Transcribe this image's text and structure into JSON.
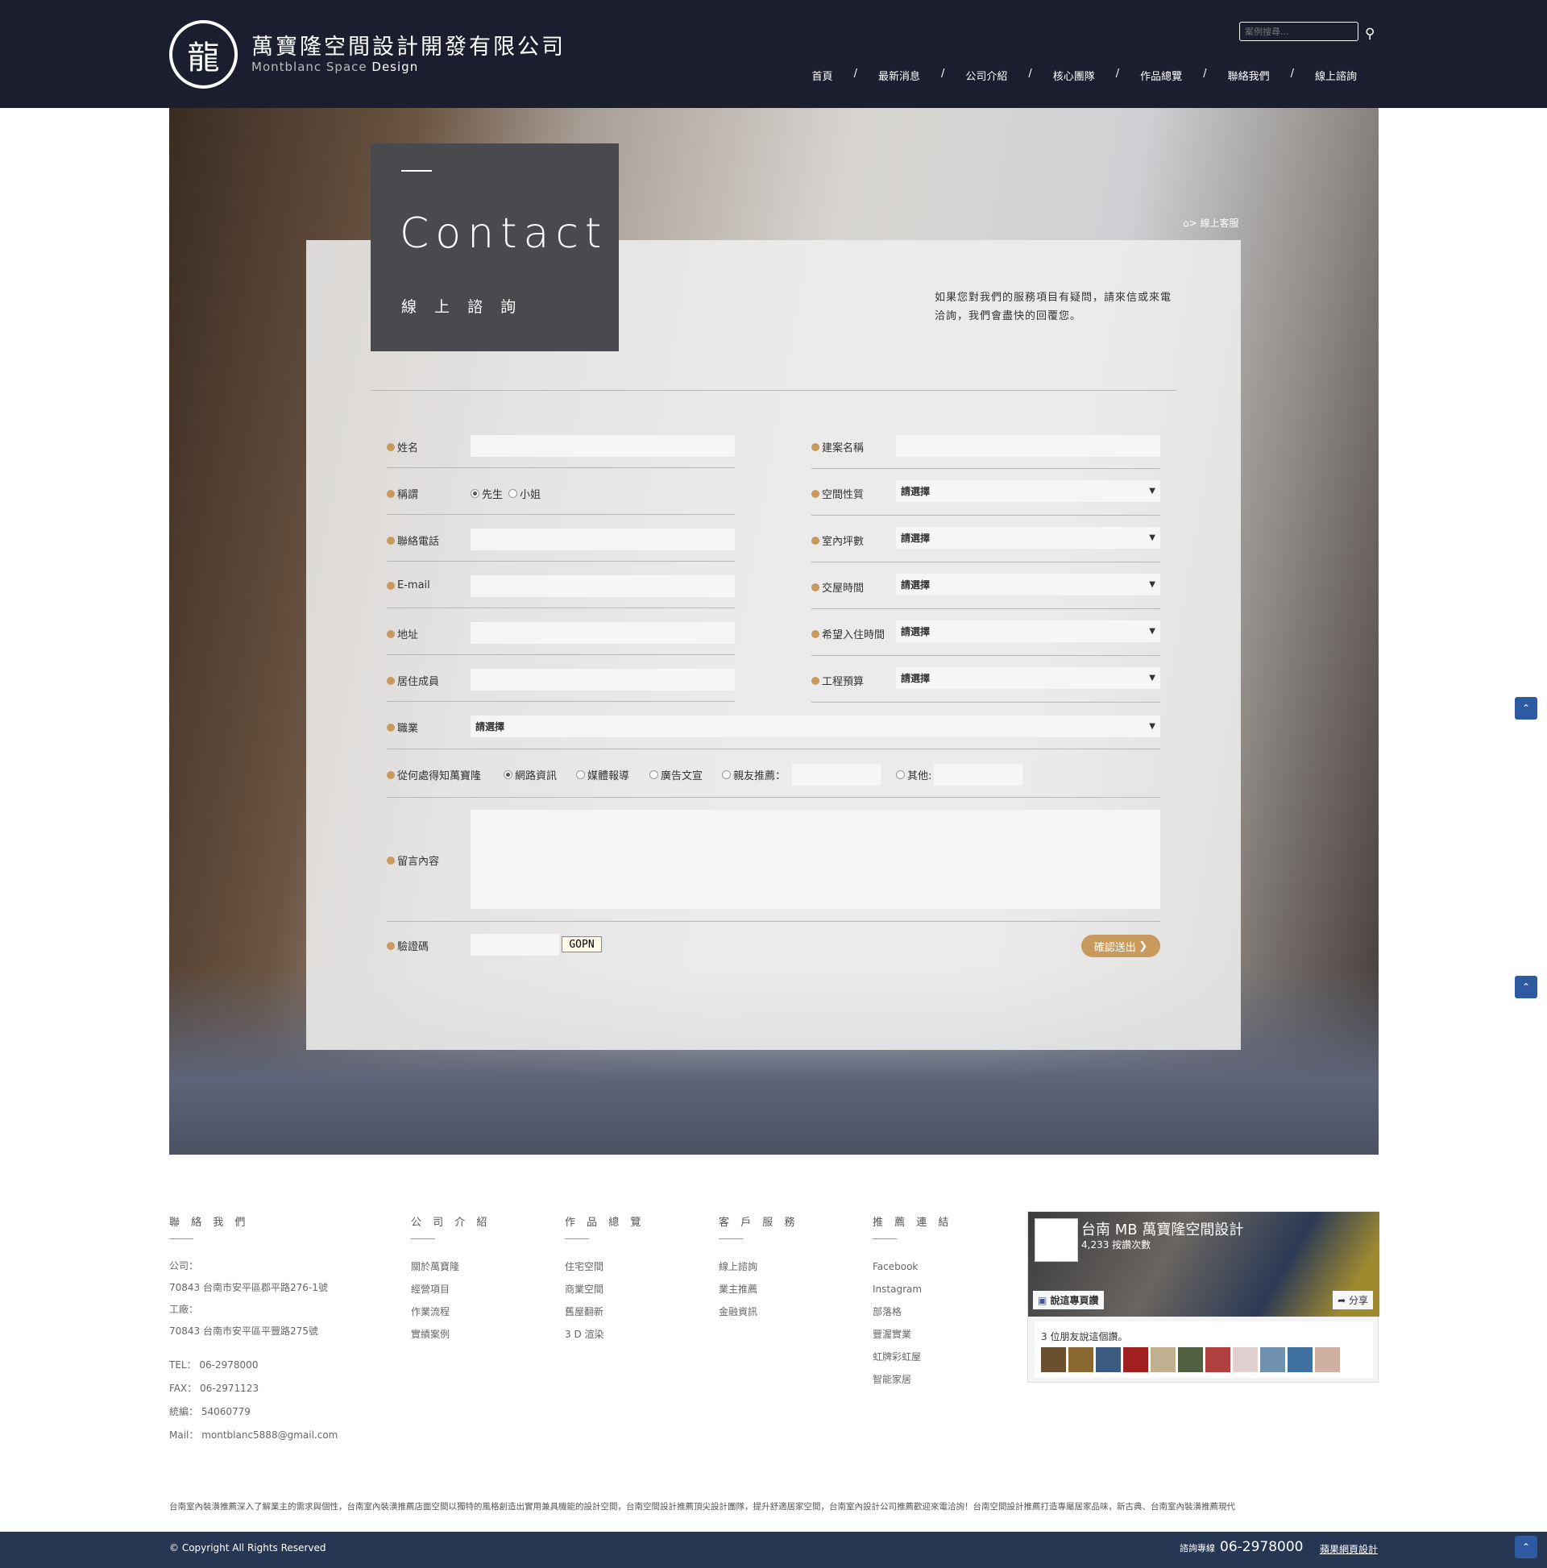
{
  "header": {
    "logo_icon": "dragon-emblem",
    "title": "萬寶隆空間設計開發有限公司",
    "subtitle_light": "Montblanc Space",
    "subtitle_bold": "Design",
    "search_placeholder": "案例搜尋...",
    "search_icon": "magnifier-icon",
    "nav": [
      "首頁",
      "最新消息",
      "公司介紹",
      "核心團隊",
      "作品總覽",
      "聯絡我們",
      "線上諮詢"
    ],
    "nav_separator": "/"
  },
  "hero": {
    "title_en": "Contact",
    "title_zh": "線 上 諮 詢",
    "breadcrumb_current": "線上客服",
    "breadcrumb_sep": ">",
    "intro": "如果您對我們的服務項目有疑問，請來信或來電洽詢，我們會盡快的回覆您。"
  },
  "form": {
    "left": [
      {
        "label": "姓名"
      },
      {
        "label": "稱謂",
        "options": [
          "先生",
          "小姐"
        ],
        "selected": "先生"
      },
      {
        "label": "聯絡電話"
      },
      {
        "label": "E-mail"
      },
      {
        "label": "地址"
      },
      {
        "label": "居住成員"
      }
    ],
    "right": [
      {
        "label": "建案名稱"
      },
      {
        "label": "空間性質",
        "value": "請選擇"
      },
      {
        "label": "室內坪數",
        "value": "請選擇"
      },
      {
        "label": "交屋時間",
        "value": "請選擇"
      },
      {
        "label": "希望入住時間",
        "value": "請選擇"
      },
      {
        "label": "工程預算",
        "value": "請選擇"
      }
    ],
    "occupation": {
      "label": "職業",
      "value": "請選擇"
    },
    "source": {
      "label": "從何處得知萬寶隆",
      "options": [
        "網路資訊",
        "媒體報導",
        "廣告文宣",
        "親友推薦：",
        "其他:"
      ],
      "selected": "網路資訊"
    },
    "message": {
      "label": "留言內容"
    },
    "captcha": {
      "label": "驗證碼",
      "code": "GOPN"
    },
    "submit": "確認送出",
    "accent": "#c89a5e"
  },
  "footer": {
    "contact": {
      "heading": "聯 絡 我 們",
      "lines": [
        "公司：",
        "70843 台南市安平區郡平路276-1號",
        "工廠：",
        "70843 台南市安平區平豐路275號",
        "",
        "TEL： 06-2978000",
        "FAX： 06-2971123",
        "統編： 54060779",
        "Mail： montblanc5888@gmail.com"
      ]
    },
    "columns": [
      {
        "heading": "公 司 介 紹",
        "items": [
          "關於萬寶隆",
          "經營項目",
          "作業流程",
          "實績案例"
        ]
      },
      {
        "heading": "作 品 總 覽",
        "items": [
          "住宅空間",
          "商業空間",
          "舊屋翻新",
          "3 D 渲染"
        ]
      },
      {
        "heading": "客 戶 服 務",
        "items": [
          "線上諮詢",
          "業主推薦",
          "金融資訊"
        ]
      },
      {
        "heading": "推 薦 連 結",
        "items": [
          "Facebook",
          "Instagram",
          "部落格",
          "豐渥實業",
          "虹牌彩虹屋",
          "智能家居"
        ]
      }
    ],
    "facebook": {
      "page_name": "台南 MB 萬寶隆空間設計",
      "likes": "4,233 按讚次數",
      "like_button": "說這專頁讚",
      "share_button": "分享",
      "friends_text": "3 位朋友說這個讚。"
    },
    "seo_text": "台南室內裝潢推薦深入了解業主的需求與個性，台南室內裝潢推薦店面空間以獨特的風格創造出實用兼具機能的設計空間，台南空間設計推薦頂尖設計團隊，提升舒適居家空間，台南室內設計公司推薦歡迎來電洽詢！台南空間設計推薦打造專屬居家品味，新古典、台南室內裝潢推薦現代",
    "copyright": "© Copyright All Rights Reserved",
    "hotline_label": "諮詢專線",
    "hotline": "06-2978000",
    "maker": "蘋果網頁設計"
  },
  "colors": {
    "header_bg": "#1b1e2e",
    "bottom_bar": "#253753",
    "accent": "#c89a5e",
    "scroll_button": "#2d5aa0"
  }
}
